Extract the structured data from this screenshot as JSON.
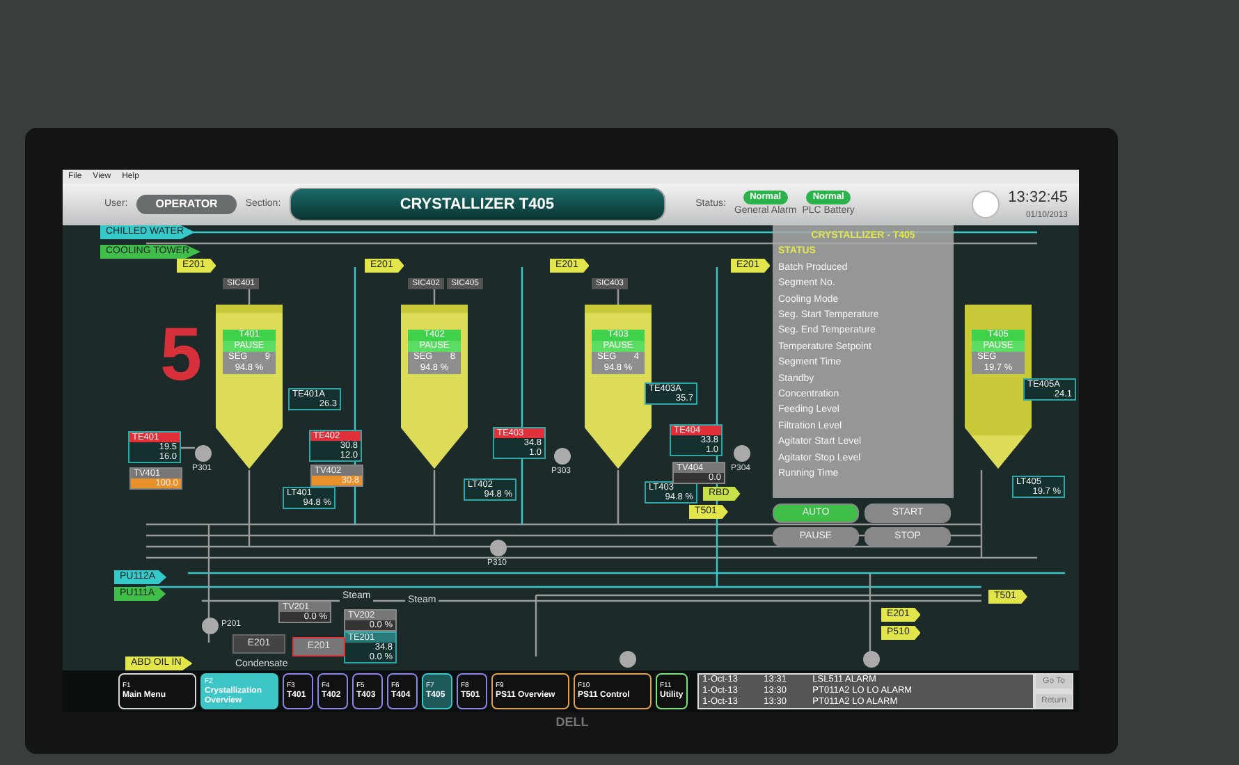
{
  "menu": [
    "File",
    "View",
    "Help"
  ],
  "header": {
    "user_label": "User:",
    "user": "OPERATOR",
    "section_label": "Section:",
    "section": "CRYSTALLIZER T405",
    "status_label": "Status:",
    "indicators": [
      {
        "value": "Normal",
        "caption": "General Alarm"
      },
      {
        "value": "Normal",
        "caption": "PLC Battery"
      }
    ],
    "time": "13:32:45",
    "date": "01/10/2013"
  },
  "big_number": "5",
  "line_tags": [
    {
      "text": "CHILLED WATER",
      "color": "#35c9c9"
    },
    {
      "text": "COOLING TOWER",
      "color": "#3fbf4a"
    },
    {
      "text": "E201",
      "color": "#e3e64a"
    },
    {
      "text": "E201",
      "color": "#e3e64a"
    },
    {
      "text": "E201",
      "color": "#e3e64a"
    },
    {
      "text": "E201",
      "color": "#e3e64a"
    },
    {
      "text": "RBD",
      "color": "#c8e04a"
    },
    {
      "text": "T501",
      "color": "#e3e64a"
    },
    {
      "text": "PU112A",
      "color": "#35c9c9"
    },
    {
      "text": "PU111A",
      "color": "#3fbf4a"
    },
    {
      "text": "ABD OIL IN",
      "color": "#e3e64a"
    },
    {
      "text": "T501",
      "color": "#e3e64a"
    },
    {
      "text": "E201",
      "color": "#e3e64a"
    },
    {
      "text": "P510",
      "color": "#e3e64a"
    }
  ],
  "controllers": [
    "SIC401",
    "SIC402",
    "SIC405",
    "SIC403"
  ],
  "tanks": [
    {
      "name": "T401",
      "state": "PAUSE",
      "seg_label": "SEG",
      "seg": "9",
      "level_text": "94.8 %",
      "level": 0.95
    },
    {
      "name": "T402",
      "state": "PAUSE",
      "seg_label": "SEG",
      "seg": "8",
      "level_text": "94.8 %",
      "level": 0.95
    },
    {
      "name": "T403",
      "state": "PAUSE",
      "seg_label": "SEG",
      "seg": "4",
      "level_text": "94.8 %",
      "level": 0.95
    },
    {
      "name": "T405",
      "state": "PAUSE",
      "seg_label": "SEG",
      "level_text": "19.7 %",
      "level": 0.2
    }
  ],
  "tags": [
    {
      "kind": "temp",
      "name": "TE401",
      "alarm": true,
      "pv": "19.5",
      "sp": "16.0"
    },
    {
      "kind": "single",
      "name": "TE401A",
      "value": "26.3"
    },
    {
      "kind": "temp",
      "name": "TE402",
      "alarm": true,
      "pv": "30.8",
      "sp": "12.0"
    },
    {
      "kind": "temp",
      "name": "TE403",
      "alarm": true,
      "pv": "34.8",
      "sp": "1.0"
    },
    {
      "kind": "single",
      "name": "TE403A",
      "value": "35.7"
    },
    {
      "kind": "temp",
      "name": "TE404",
      "alarm": true,
      "pv": "33.8",
      "sp": "1.0"
    },
    {
      "kind": "single",
      "name": "TE405A",
      "value": "24.1"
    },
    {
      "kind": "single",
      "name": "LT401",
      "value": "94.8 %"
    },
    {
      "kind": "single",
      "name": "LT402",
      "value": "94.8 %"
    },
    {
      "kind": "single",
      "name": "LT403",
      "value": "94.8 %"
    },
    {
      "kind": "single",
      "name": "LT405",
      "value": "19.7 %"
    },
    {
      "kind": "valve",
      "name": "TV401",
      "active": true,
      "value": "100.0"
    },
    {
      "kind": "valve",
      "name": "TV402",
      "active": true,
      "value": "30.8"
    },
    {
      "kind": "valve",
      "name": "TV404",
      "active": false,
      "value": "0.0"
    },
    {
      "kind": "temp",
      "name": "TE201",
      "alarm": false,
      "pv": "34.8",
      "sp": "0.0 %"
    },
    {
      "kind": "valve",
      "name": "TV201",
      "active": false,
      "value": "0.0 %"
    },
    {
      "kind": "valve",
      "name": "TV202",
      "active": false,
      "value": "0.0 %"
    }
  ],
  "pumps": [
    {
      "name": "P301"
    },
    {
      "name": "P303"
    },
    {
      "name": "P304"
    },
    {
      "name": "P310"
    },
    {
      "name": "P201"
    }
  ],
  "exchangers": [
    {
      "name": "E201",
      "alarm": false
    },
    {
      "name": "E201",
      "alarm": true
    }
  ],
  "notes": [
    "Steam",
    "Steam",
    "Condensate"
  ],
  "status_panel": {
    "title": "CRYSTALLIZER - T405",
    "heading": "STATUS",
    "rows": [
      "Batch Produced",
      "Segment No.",
      "Cooling Mode",
      "Seg. Start Temperature",
      "Seg. End Temperature",
      "Temperature Setpoint",
      "Segment Time",
      "Standby",
      "Concentration",
      "Feeding Level",
      "Filtration Level",
      "Agitator Start Level",
      "Agitator Stop Level",
      "Running Time"
    ],
    "buttons": [
      {
        "label": "AUTO",
        "on": true
      },
      {
        "label": "START",
        "on": false
      },
      {
        "label": "PAUSE",
        "on": false
      },
      {
        "label": "STOP",
        "on": false
      }
    ]
  },
  "nav": [
    {
      "key": "F1",
      "label": "Main Menu",
      "color": "#d8d8d8",
      "selected": false
    },
    {
      "key": "F2",
      "label": "Crystallization Overview",
      "color": "#3ec6c6",
      "selected": true
    },
    {
      "key": "F3",
      "label": "T401",
      "color": "#8a86e8",
      "selected": false
    },
    {
      "key": "F4",
      "label": "T402",
      "color": "#8a86e8",
      "selected": false
    },
    {
      "key": "F5",
      "label": "T403",
      "color": "#8a86e8",
      "selected": false
    },
    {
      "key": "F6",
      "label": "T404",
      "color": "#8a86e8",
      "selected": false
    },
    {
      "key": "F7",
      "label": "T405",
      "color": "#3ec6c6",
      "selected": true
    },
    {
      "key": "F8",
      "label": "T501",
      "color": "#8a86e8",
      "selected": false
    },
    {
      "key": "F9",
      "label": "PS11 Overview",
      "color": "#e0a050",
      "selected": false
    },
    {
      "key": "F10",
      "label": "PS11 Control",
      "color": "#e0a050",
      "selected": false
    },
    {
      "key": "F11",
      "label": "Utility",
      "color": "#7fe07f",
      "selected": false
    }
  ],
  "alarms": [
    {
      "date": "1-Oct-13",
      "time": "13:31",
      "message": "LSL511 ALARM"
    },
    {
      "date": "1-Oct-13",
      "time": "13:30",
      "message": "PT011A2 LO LO ALARM"
    },
    {
      "date": "1-Oct-13",
      "time": "13:30",
      "message": "PT011A2 LO ALARM"
    }
  ],
  "alarm_buttons": [
    "Go To",
    "Return"
  ],
  "monitor_brand": "DELL"
}
